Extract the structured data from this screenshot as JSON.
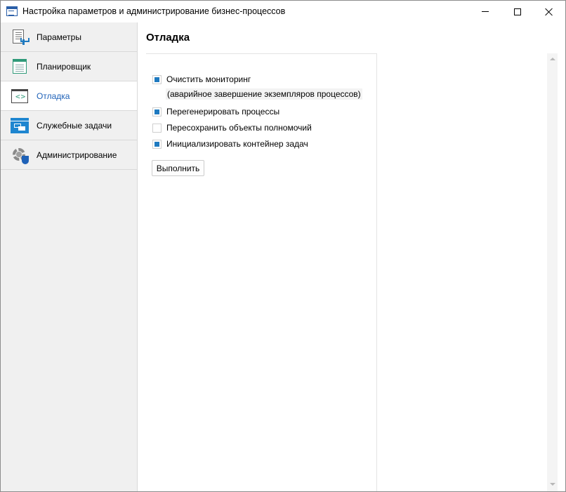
{
  "window": {
    "title": "Настройка параметров и администрирование бизнес-процессов"
  },
  "sidebar": {
    "items": [
      {
        "label": "Параметры",
        "icon": "parameters-icon",
        "active": false
      },
      {
        "label": "Планировщик",
        "icon": "calendar-icon",
        "active": false
      },
      {
        "label": "Отладка",
        "icon": "code-icon",
        "active": true
      },
      {
        "label": "Служебные задачи",
        "icon": "service-tasks-icon",
        "active": false
      },
      {
        "label": "Администрирование",
        "icon": "gear-shield-icon",
        "active": false
      }
    ]
  },
  "main": {
    "title": "Отладка",
    "options": [
      {
        "label": "Очистить мониторинг",
        "checked": true
      },
      {
        "label": "Перегенерировать процессы",
        "checked": true
      },
      {
        "label": "Пересохранить объекты полномочий",
        "checked": false
      },
      {
        "label": "Инициализировать контейнер задач",
        "checked": true
      }
    ],
    "option_note": "(аварийное завершение экземпляров процессов)",
    "run_button": "Выполнить"
  },
  "colors": {
    "accent": "#1f7ac0",
    "active_nav_text": "#1f62b8",
    "sidebar_bg": "#f0f0f0"
  }
}
